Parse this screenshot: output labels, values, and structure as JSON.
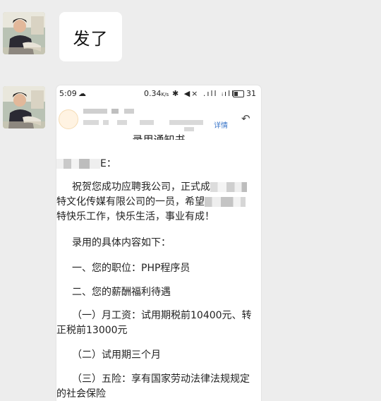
{
  "chat": {
    "message1": "发了",
    "avatar_icon": "user-avatar-icon"
  },
  "screenshot": {
    "status": {
      "time": "5:09",
      "net_speed": "0.34",
      "battery": "31"
    },
    "mail_header": {
      "detail_link": "详情"
    },
    "doc": {
      "title": "录用通知书",
      "salutation_suffix": "E：",
      "p1_line1": "祝贺您成功应聘我公司，正式成",
      "p1_line2": "特文化传媒有限公司的一员，希望",
      "p1_line3": "特快乐工作，快乐生活，事业有成！",
      "p2": "录用的具体内容如下：",
      "p3": "一、您的职位：PHP程序员",
      "p4": "二、您的薪酬福利待遇",
      "p5_line1": "（一）月工资：试用期税前10400元、转",
      "p5_line2": "正税前13000元",
      "p6": "（二）试用期三个月",
      "p7_line1": "（三）五险：享有国家劳动法律法规规定",
      "p7_line2": "的社会保险"
    }
  }
}
